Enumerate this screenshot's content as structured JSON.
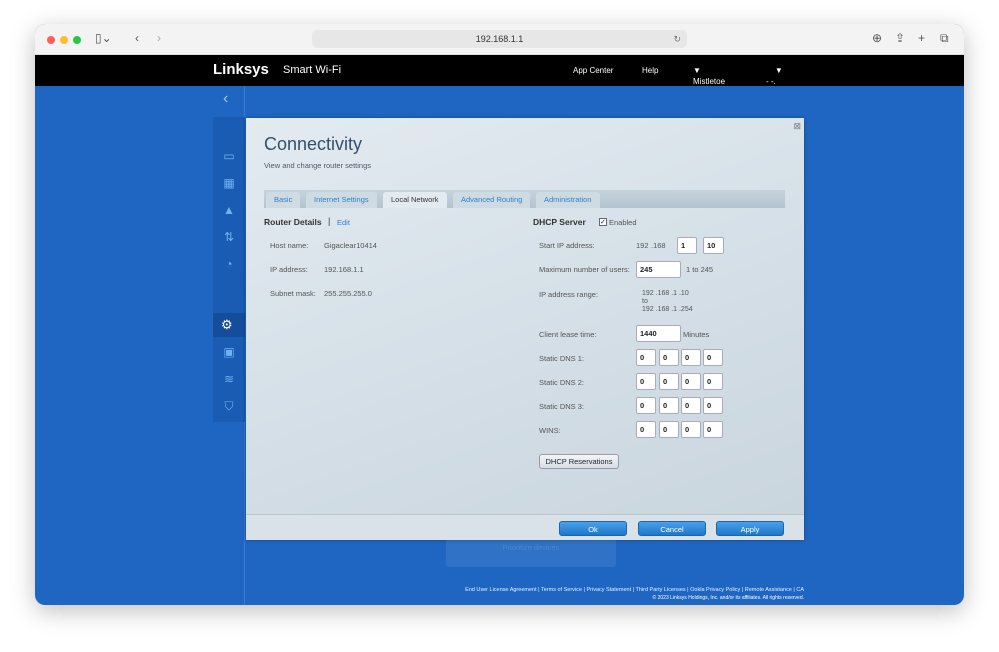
{
  "browser": {
    "url": "192.168.1.1"
  },
  "header": {
    "brand": "Linksys",
    "product": "Smart Wi-Fi",
    "app_center": "App Center",
    "help": "Help",
    "network": "Mistletoe",
    "user": "- -."
  },
  "modal": {
    "title": "Connectivity",
    "subtitle": "View and change router settings",
    "tabs": [
      "Basic",
      "Internet Settings",
      "Local Network",
      "Advanced Routing",
      "Administration"
    ],
    "router": {
      "heading": "Router Details",
      "edit": "Edit",
      "host_label": "Host name:",
      "host": "Gigaclear10414",
      "ip_label": "IP address:",
      "ip": "192.168.1.1",
      "mask_label": "Subnet mask:",
      "mask": "255.255.255.0"
    },
    "dhcp": {
      "heading": "DHCP Server",
      "enabled": "Enabled",
      "start_label": "Start IP address:",
      "start": [
        "192",
        ".168",
        ".",
        "1",
        ".",
        "10"
      ],
      "max_label": "Maximum number of users:",
      "max": "245",
      "max_range": "1 to 245",
      "range_label": "IP address range:",
      "range_from": "192 .168 .1 .10",
      "to": "to",
      "range_to": "192 .168 .1 .254",
      "lease_label": "Client lease time:",
      "lease": "1440",
      "minutes": "Minutes",
      "dns1_label": "Static DNS 1:",
      "dns2_label": "Static DNS 2:",
      "dns3_label": "Static DNS 3:",
      "wins_label": "WINS:",
      "zero": "0",
      "reservations": "DHCP Reservations"
    },
    "ok": "Ok",
    "cancel": "Cancel",
    "apply": "Apply"
  },
  "behind": "Prioritize devices",
  "footer": {
    "links": [
      "End User License Agreement",
      "Terms of Service",
      "Privacy Statement",
      "Third Party Licenses",
      "Ookla Privacy Policy",
      "Remote Assistance",
      "CA"
    ],
    "copyright": "© 2023 Linksys Holdings, Inc. and/or its affiliates. All rights reserved."
  }
}
